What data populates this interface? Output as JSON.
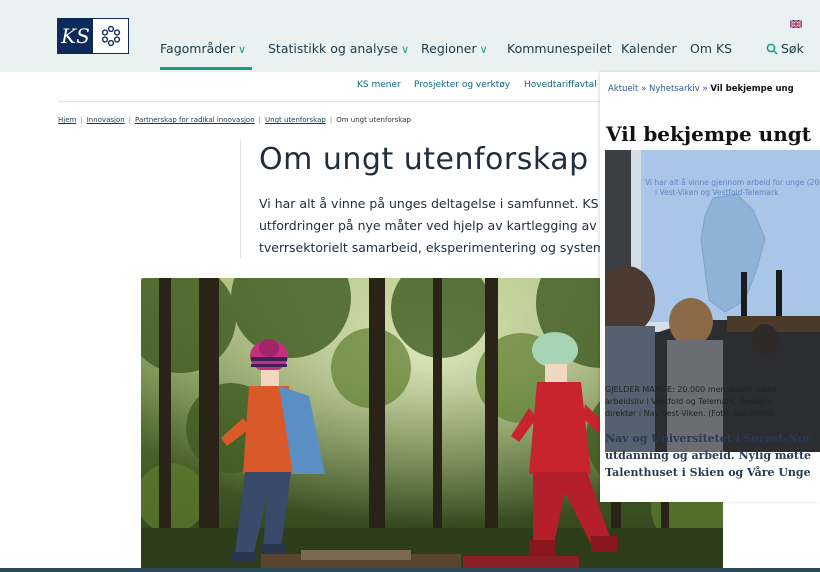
{
  "header": {
    "logo_text": "KS",
    "nav": [
      "Fagområder",
      "Statistikk og analyse",
      "Regioner",
      "Kommunespeilet",
      "Kalender",
      "Om KS"
    ],
    "search_label": "Søk"
  },
  "subnav": [
    "KS mener",
    "Prosjekter og verktøy",
    "Hovedtariffavtal"
  ],
  "breadcrumb": [
    "Hjem",
    "Innovasjon",
    "Partnerskap for radikal innovasjon",
    "Ungt utenforskap",
    "Om ungt utenforskap"
  ],
  "page": {
    "title": "Om ungt utenforskap",
    "intro": [
      "Vi har alt å vinne på unges deltagelse i samfunnet. KS F",
      "utfordringer på nye måter ved hjelp av kartlegging av r",
      "tverrsektorielt samarbeid, eksperimentering og system"
    ]
  },
  "overlay": {
    "crumb_parts": [
      "Aktuelt",
      "»",
      "Nyhetsarkiv",
      "»"
    ],
    "crumb_current": "Vil bekjempe ung",
    "title": "Vil bekjempe ungt",
    "slide_text": [
      "Vi har alt å vinne gjennom arbeid for unge (20-",
      "i Vest-Viken og Vestfold-Telemark"
    ],
    "caption": [
      "GJELDER MANGE: 20.000 mennesker mello",
      "arbeidsliv i Vestfold og Telemark, Buskeru",
      "direktør i Nav Vest-Viken. (Foto: Jan-Henrik"
    ],
    "lead": [
      "Nav og Universitetet i Sørøst-Nor",
      "utdanning og arbeid. Nylig møtte",
      "Talenthuset i Skien og Våre Unge"
    ]
  },
  "colors": {
    "header_bg": "#e9f2f0",
    "accent": "#1b9a8a",
    "logo_navy": "#0d2a5c",
    "link": "#0d6a7d"
  }
}
